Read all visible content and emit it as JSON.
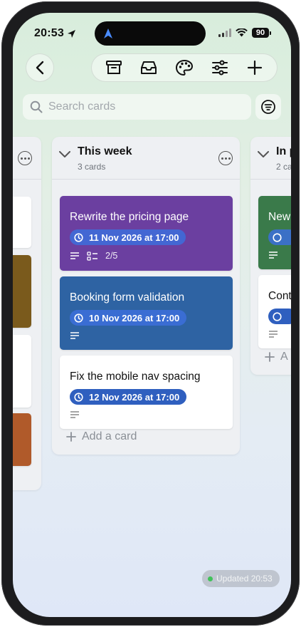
{
  "status_bar": {
    "time": "20:53",
    "battery": "90"
  },
  "toolbar": {
    "icons": [
      "archive-icon",
      "inbox-icon",
      "palette-icon",
      "sliders-icon",
      "plus-icon"
    ]
  },
  "search": {
    "placeholder": "Search cards"
  },
  "columns": {
    "main": {
      "title": "This week",
      "count": "3 cards",
      "cards": [
        {
          "title": "Rewrite the pricing page",
          "due": "11 Nov 2026 at 17:00",
          "checklist": "2/5",
          "color": "#6b3fa0"
        },
        {
          "title": "Booking form validation",
          "due": "10 Nov 2026 at 17:00",
          "color": "#2e63a3"
        },
        {
          "title": "Fix the mobile nav spacing",
          "due": "12 Nov 2026 at 17:00",
          "color": "#ffffff"
        }
      ],
      "add_label": "Add a card"
    },
    "right": {
      "title": "In p",
      "count": "2 ca",
      "cards": [
        {
          "title": "New",
          "color": "#3a7a4a"
        },
        {
          "title": "Cont",
          "color": "#ffffff"
        }
      ],
      "add_label": "A"
    },
    "left": {
      "card_colors": [
        "#ffffff",
        "#7a5a1c",
        "#ffffff",
        "#b05a2a"
      ]
    }
  },
  "updated_label": "Updated 20:53",
  "colors": {
    "accent": "#2f5fbf",
    "online": "#41c15a"
  }
}
